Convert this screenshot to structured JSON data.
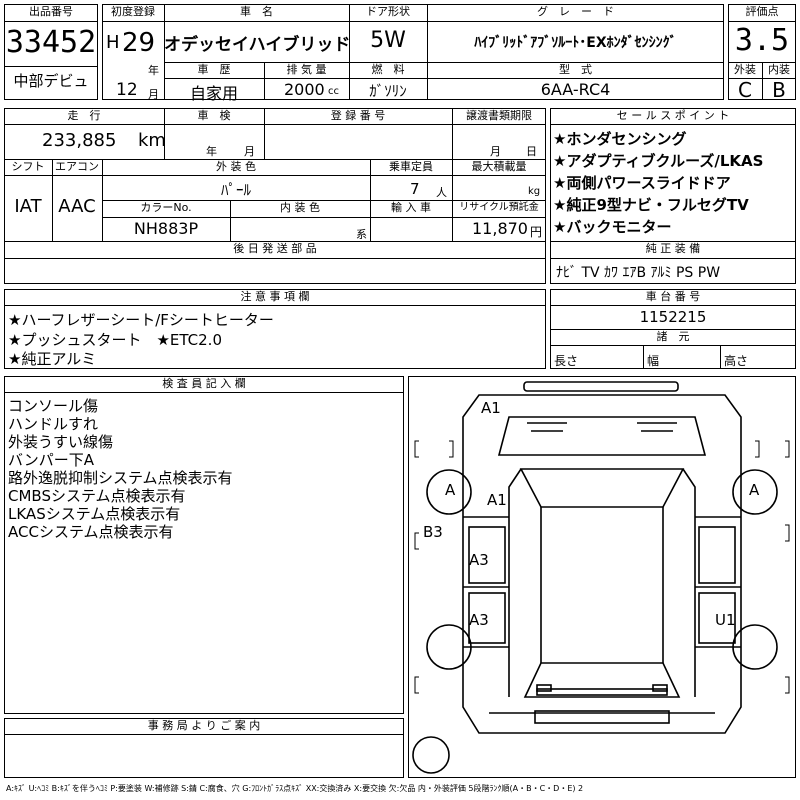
{
  "listing": {
    "lot_label": "出品番号",
    "lot_number": "33452",
    "debut_label": "中部デビュ",
    "first_reg_label": "初度登録",
    "era": "H",
    "year": "29",
    "year_unit": "年",
    "month": "12",
    "month_unit": "月",
    "model_label": "車　名",
    "model": "オデッセイハイブリッド",
    "door_label": "ドア形状",
    "door": "5W",
    "grade_label": "グ　レ　ー　ド",
    "grade": "ﾊｲﾌﾞﾘｯﾄﾞｱﾌﾞｿﾙｰﾄ･EXﾎﾝﾀﾞｾﾝｼﾝｸﾞ",
    "score_label": "評価点",
    "score": "3.5",
    "history_label": "車　歴",
    "history": "自家用",
    "displacement_label": "排 気 量",
    "displacement": "2000",
    "displacement_unit": "cc",
    "fuel_label": "燃　料",
    "fuel": "ｶﾞｿﾘﾝ",
    "type_label": "型　式",
    "type_code": "6AA-RC4",
    "exterior_label": "外装",
    "exterior_grade": "C",
    "interior_label": "内装",
    "interior_grade": "B"
  },
  "details": {
    "mileage_label": "走　行",
    "mileage": "233,885",
    "mileage_unit": "km",
    "inspection_label": "車　検",
    "inspection_year_unit": "年",
    "inspection_month_unit": "月",
    "reg_no_label": "登 録 番 号",
    "transfer_label": "譲渡書類期限",
    "transfer_month_unit": "月",
    "transfer_day_unit": "日",
    "shift_label": "シフト",
    "shift": "IAT",
    "ac_label": "エアコン",
    "ac": "AAC",
    "color_label": "外 装 色",
    "color": "ﾊﾟｰﾙ",
    "seats_label": "乗車定員",
    "seats": "7",
    "seats_unit": "人",
    "load_label": "最大積載量",
    "load_unit": "kg",
    "color_no_label": "カラーNo.",
    "color_no": "NH883P",
    "int_color_label": "内 装 色",
    "int_color_unit": "系",
    "import_label": "輸 入 車",
    "recycle_label": "リサイクル預託金",
    "recycle": "11,870",
    "recycle_unit": "円",
    "parts_label": "後 日 発 送 部 品"
  },
  "sales_points": {
    "label": "セ ー ル ス ポ イ ン ト",
    "items": [
      "★ホンダセンシング",
      "★アダプティブクルーズ/LKAS",
      "★両側パワースライドドア",
      "★純正9型ナビ・フルセグTV",
      "★バックモニター"
    ]
  },
  "equipment": {
    "label": "純 正 装 備",
    "value": "ﾅﾋﾞ TV ｶﾜ ｴｱB ｱﾙﾐ PS PW"
  },
  "notes": {
    "label": "注 意 事 項 欄",
    "lines": [
      "★ハーフレザーシート/Fシートヒーター",
      "★プッシュスタート　★ETC2.0",
      "★純正アルミ"
    ]
  },
  "chassis": {
    "label": "車 台 番 号",
    "value": "1152215",
    "dims_label": "諸　元",
    "length_label": "長さ",
    "width_label": "幅",
    "height_label": "高さ"
  },
  "inspector": {
    "label": "検 査 員 記 入 欄",
    "lines": [
      "コンソール傷",
      "ハンドルすれ",
      "外装うすい線傷",
      "バンパー下A",
      "路外逸脱抑制システム点検表示有",
      "CMBSシステム点検表示有",
      "LKASシステム点検表示有",
      "ACCシステム点検表示有"
    ]
  },
  "office": {
    "label": "事 務 局 よ り ご 案 内"
  },
  "diagram": {
    "marks": {
      "front_top": "A1",
      "left_front_wheel": "A",
      "right_front_wheel": "A",
      "front_left_body": "A1",
      "left_side": "B3",
      "left_front_door": "A3",
      "left_rear_door": "A3",
      "right_rear_door": "U1"
    }
  },
  "legend": "A:ｷｽﾞ U:ﾍｺﾐ B:ｷｽﾞを伴うﾍｺﾐ P:要塗装 W:補修跡 S:錆 C:腐食、穴 G:ﾌﾛﾝﾄｶﾞﾗｽ点ｷｽﾞ XX:交換済み X:要交換 欠:欠品 内・外装評価 5段階ﾗﾝｸ順(A・B・C・D・E) 2"
}
